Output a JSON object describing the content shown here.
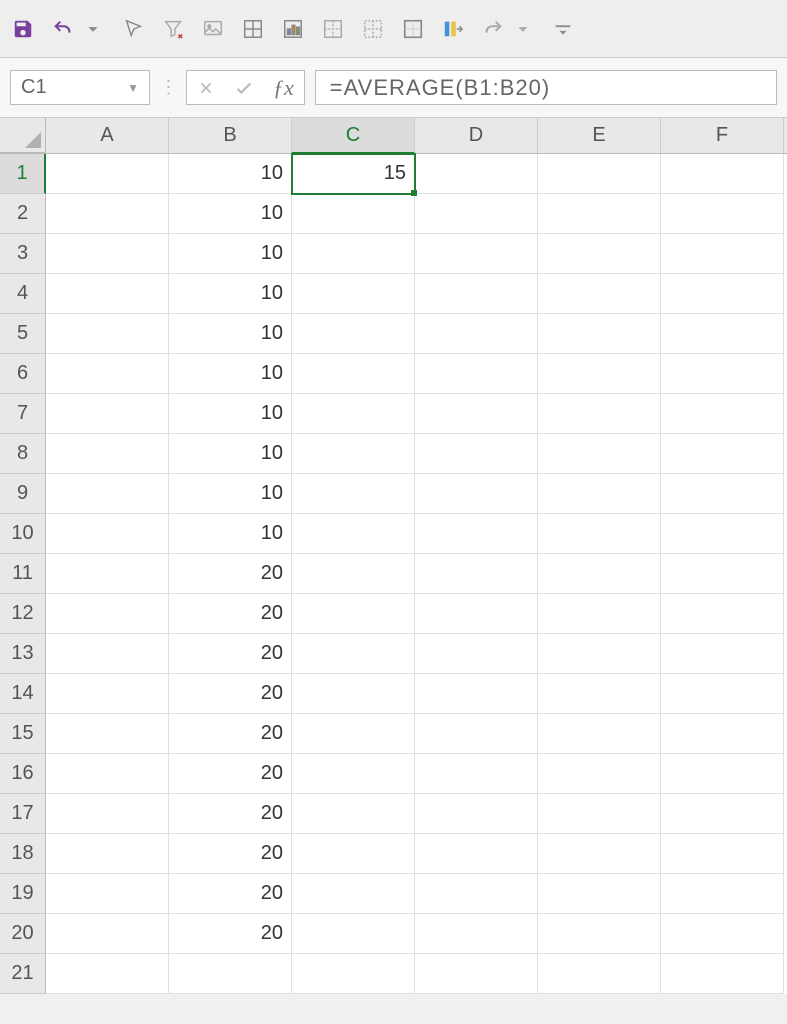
{
  "toolbar": {
    "icons": [
      "save-icon",
      "undo-icon",
      "dropdown-icon",
      "cursor-icon",
      "clear-filter-icon",
      "image-icon",
      "border-all-icon",
      "chart-icon",
      "border-outer-icon",
      "border-none-icon",
      "border-box-icon",
      "columns-icon",
      "redo-icon",
      "dropdown-icon",
      "overflow-icon"
    ]
  },
  "namebox": {
    "value": "C1"
  },
  "formula": {
    "value": "=AVERAGE(B1:B20)"
  },
  "columns": [
    "A",
    "B",
    "C",
    "D",
    "E",
    "F"
  ],
  "selected_cell": {
    "row": 1,
    "col": "C"
  },
  "rows": [
    {
      "n": 1,
      "A": "",
      "B": "10",
      "C": "15",
      "D": "",
      "E": "",
      "F": ""
    },
    {
      "n": 2,
      "A": "",
      "B": "10",
      "C": "",
      "D": "",
      "E": "",
      "F": ""
    },
    {
      "n": 3,
      "A": "",
      "B": "10",
      "C": "",
      "D": "",
      "E": "",
      "F": ""
    },
    {
      "n": 4,
      "A": "",
      "B": "10",
      "C": "",
      "D": "",
      "E": "",
      "F": ""
    },
    {
      "n": 5,
      "A": "",
      "B": "10",
      "C": "",
      "D": "",
      "E": "",
      "F": ""
    },
    {
      "n": 6,
      "A": "",
      "B": "10",
      "C": "",
      "D": "",
      "E": "",
      "F": ""
    },
    {
      "n": 7,
      "A": "",
      "B": "10",
      "C": "",
      "D": "",
      "E": "",
      "F": ""
    },
    {
      "n": 8,
      "A": "",
      "B": "10",
      "C": "",
      "D": "",
      "E": "",
      "F": ""
    },
    {
      "n": 9,
      "A": "",
      "B": "10",
      "C": "",
      "D": "",
      "E": "",
      "F": ""
    },
    {
      "n": 10,
      "A": "",
      "B": "10",
      "C": "",
      "D": "",
      "E": "",
      "F": ""
    },
    {
      "n": 11,
      "A": "",
      "B": "20",
      "C": "",
      "D": "",
      "E": "",
      "F": ""
    },
    {
      "n": 12,
      "A": "",
      "B": "20",
      "C": "",
      "D": "",
      "E": "",
      "F": ""
    },
    {
      "n": 13,
      "A": "",
      "B": "20",
      "C": "",
      "D": "",
      "E": "",
      "F": ""
    },
    {
      "n": 14,
      "A": "",
      "B": "20",
      "C": "",
      "D": "",
      "E": "",
      "F": ""
    },
    {
      "n": 15,
      "A": "",
      "B": "20",
      "C": "",
      "D": "",
      "E": "",
      "F": ""
    },
    {
      "n": 16,
      "A": "",
      "B": "20",
      "C": "",
      "D": "",
      "E": "",
      "F": ""
    },
    {
      "n": 17,
      "A": "",
      "B": "20",
      "C": "",
      "D": "",
      "E": "",
      "F": ""
    },
    {
      "n": 18,
      "A": "",
      "B": "20",
      "C": "",
      "D": "",
      "E": "",
      "F": ""
    },
    {
      "n": 19,
      "A": "",
      "B": "20",
      "C": "",
      "D": "",
      "E": "",
      "F": ""
    },
    {
      "n": 20,
      "A": "",
      "B": "20",
      "C": "",
      "D": "",
      "E": "",
      "F": ""
    },
    {
      "n": 21,
      "A": "",
      "B": "",
      "C": "",
      "D": "",
      "E": "",
      "F": ""
    }
  ]
}
